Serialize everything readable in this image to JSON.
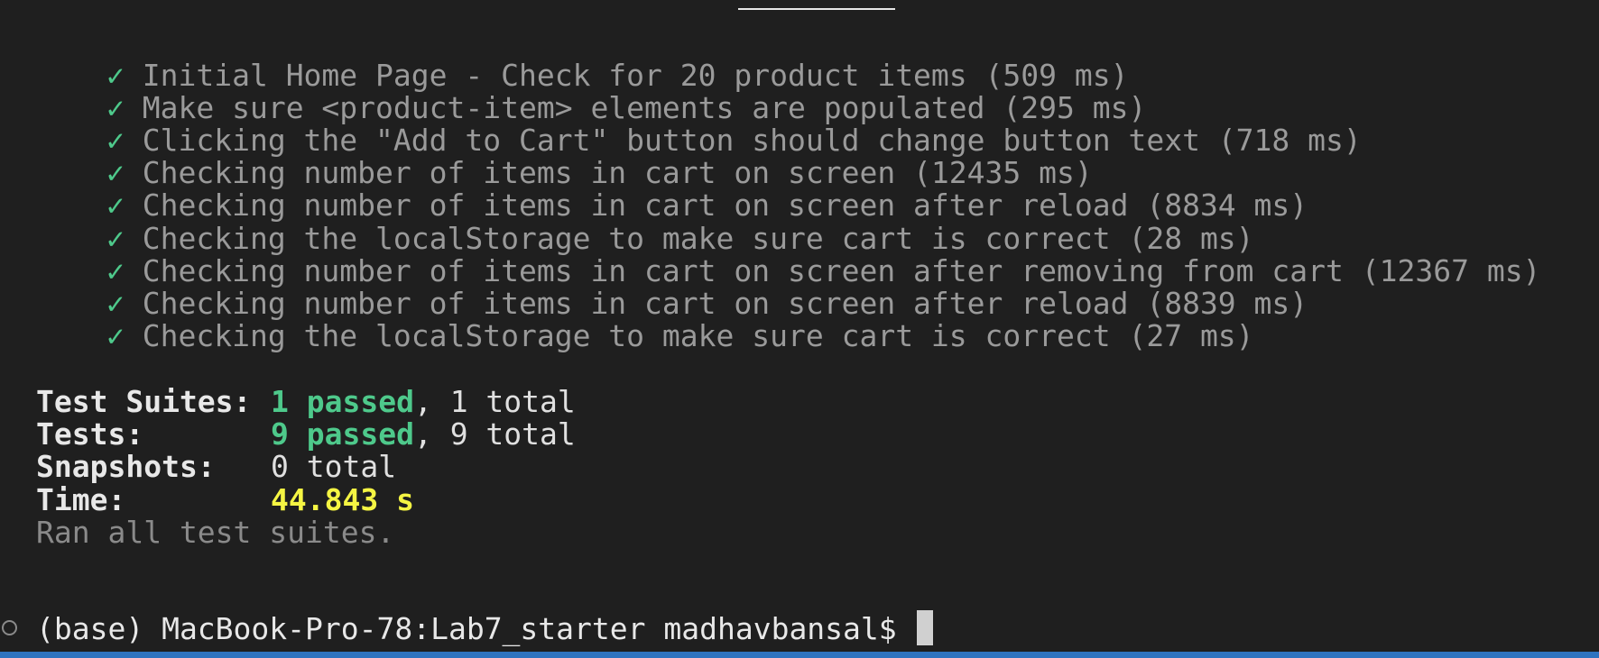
{
  "tests": [
    {
      "check": "✓",
      "text": "Initial Home Page - Check for 20 product items (509 ms)"
    },
    {
      "check": "✓",
      "text": "Make sure <product-item> elements are populated (295 ms)"
    },
    {
      "check": "✓",
      "text": "Clicking the \"Add to Cart\" button should change button text (718 ms)"
    },
    {
      "check": "✓",
      "text": "Checking number of items in cart on screen (12435 ms)"
    },
    {
      "check": "✓",
      "text": "Checking number of items in cart on screen after reload (8834 ms)"
    },
    {
      "check": "✓",
      "text": "Checking the localStorage to make sure cart is correct (28 ms)"
    },
    {
      "check": "✓",
      "text": "Checking number of items in cart on screen after removing from cart (12367 ms)"
    },
    {
      "check": "✓",
      "text": "Checking number of items in cart on screen after reload (8839 ms)"
    },
    {
      "check": "✓",
      "text": "Checking the localStorage to make sure cart is correct (27 ms)"
    }
  ],
  "summary": {
    "suites_label": "Test Suites:",
    "suites_passed": "1 passed",
    "suites_rest": ", 1 total",
    "tests_label": "Tests:",
    "tests_passed": "9 passed",
    "tests_rest": ", 9 total",
    "snapshots_label": "Snapshots:",
    "snapshots_value": "0 total",
    "time_label": "Time:",
    "time_value": "44.843 s",
    "ran_text": "Ran all test suites."
  },
  "prompt": {
    "text": "(base) MacBook-Pro-78:Lab7_starter madhavbansal$ "
  },
  "colors": {
    "background": "#1f1f1f",
    "pass_green": "#4ec98b",
    "time_yellow": "#f5f543",
    "status_bar_blue": "#2f74c0"
  }
}
